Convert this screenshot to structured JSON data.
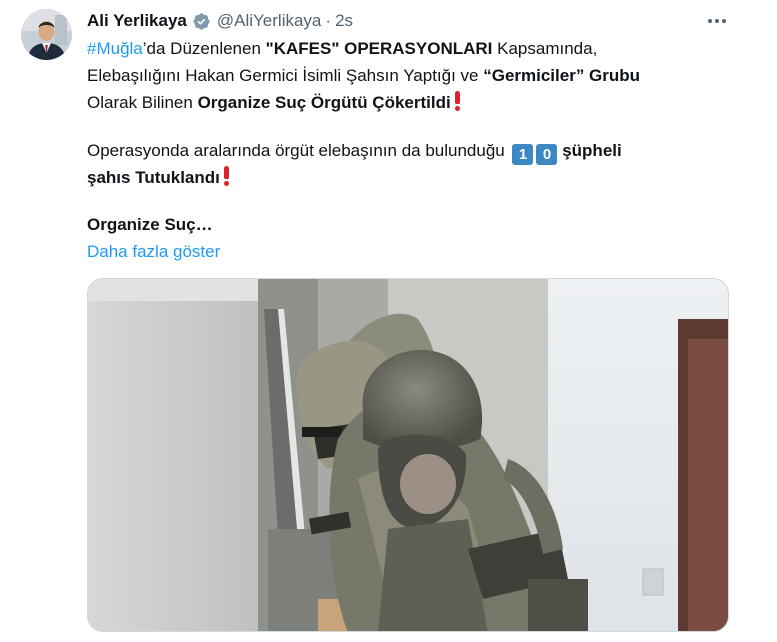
{
  "tweet": {
    "author": {
      "display_name": "Ali Yerlikaya",
      "verified_icon": "verified-badge-icon",
      "handle": "@AliYerlikaya",
      "separator": "·",
      "time": "2s"
    },
    "more_icon": "more-horizontal-icon",
    "lines": [
      {
        "hashtag": "#Muğla",
        "t1": "’da Düzenlenen ",
        "b1": "\"KAFES\" OPERASYONLARI",
        "t2": " Kapsamında,"
      },
      {
        "t1": "Elebaşılığını Hakan Germici İsimli Şahsın Yaptığı ve ",
        "b1": "“Germiciler” Grubu"
      },
      {
        "t1": "Olarak Bilinen ",
        "b1": "Organize Suç Örgütü Çökertildi"
      },
      {
        "t1": "Operasyonda aralarında örgüt elebaşının da bulunduğu ",
        "keycap1": "1",
        "keycap2": "0",
        "b1": " şüpheli"
      },
      {
        "b1": "şahıs Tutuklandı"
      },
      {
        "b1": "Organize Suç…"
      }
    ],
    "show_more": "Daha fazla göster",
    "emoji": {
      "exclamation": "red-exclamation-icon",
      "keycap_color": "#3b88c3"
    },
    "media": {
      "type": "video-thumbnail",
      "description_icon": "video-thumbnail-image"
    }
  },
  "colors": {
    "link": "#1d9bf0",
    "text": "#0f1419",
    "secondary": "#536471"
  }
}
